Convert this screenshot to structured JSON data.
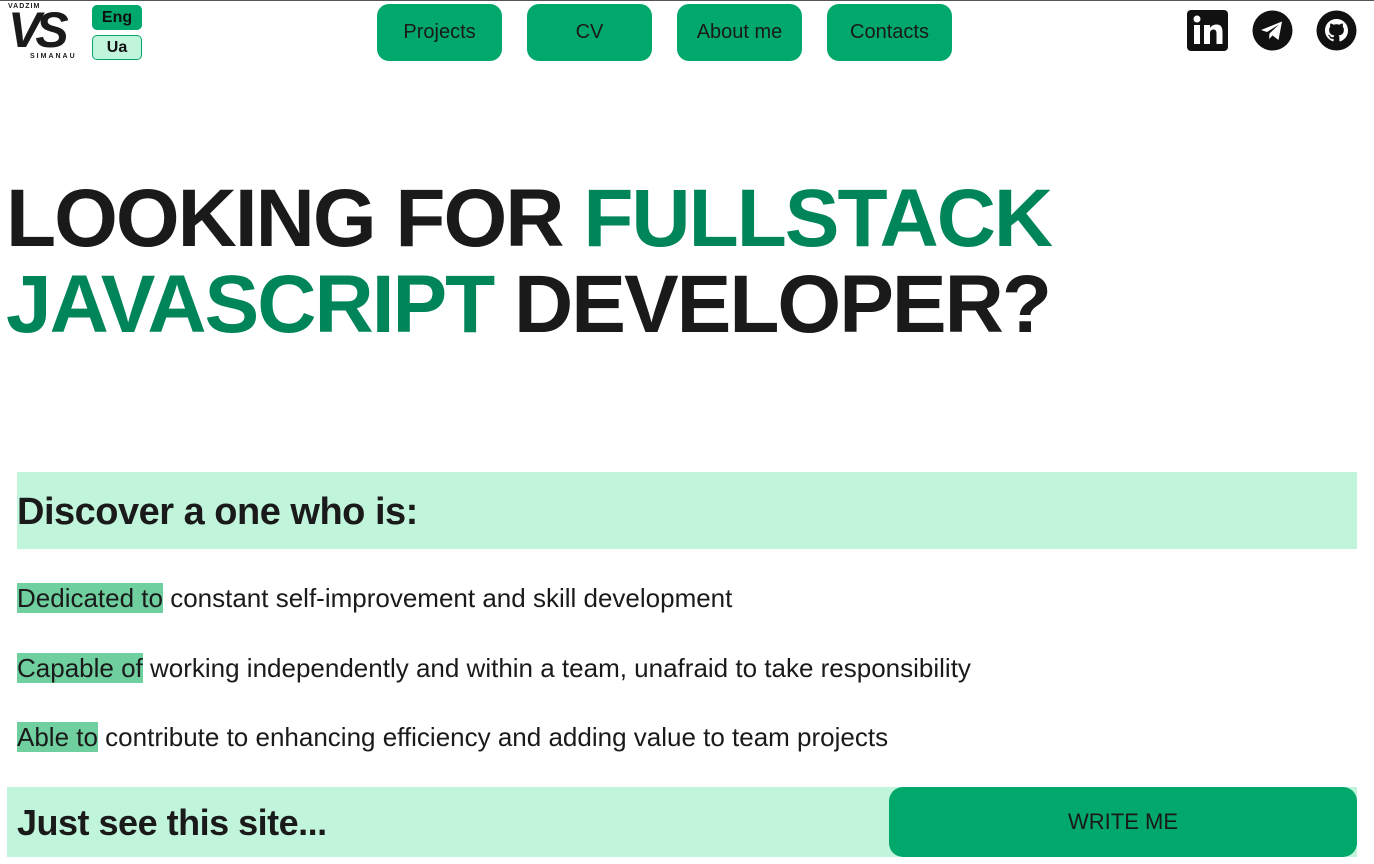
{
  "logo": {
    "top_text": "VADZIM",
    "mark": "VS",
    "bottom_text": "SIMANAU"
  },
  "languages": [
    {
      "label": "Eng",
      "active": true
    },
    {
      "label": "Ua",
      "active": false
    }
  ],
  "nav": {
    "projects": "Projects",
    "cv": "CV",
    "about": "About me",
    "contacts": "Contacts"
  },
  "social": {
    "linkedin_icon": "linkedin-icon",
    "telegram_icon": "telegram-icon",
    "github_icon": "github-icon"
  },
  "hero": {
    "part1": "LOOKING FOR ",
    "accent1": "FULLSTACK",
    "accent2": "JAVASCRIPT",
    "part2": " DEVELOPER?"
  },
  "discover": {
    "title": "Discover a one who is:",
    "points": [
      {
        "highlight": "Dedicated to",
        "text": " constant self-improvement and skill development"
      },
      {
        "highlight": "Capable of",
        "text": " working independently and within a team, unafraid to take responsibility"
      },
      {
        "highlight": "Able to",
        "text": " contribute to enhancing efficiency and adding value to team projects"
      }
    ]
  },
  "footer": {
    "tagline": "Just see this site...",
    "cta": "WRITE ME"
  },
  "colors": {
    "primary": "#00a86b",
    "accent_text": "#00855a",
    "light_band": "#c0f5dc",
    "highlight": "#6fcf9f"
  }
}
